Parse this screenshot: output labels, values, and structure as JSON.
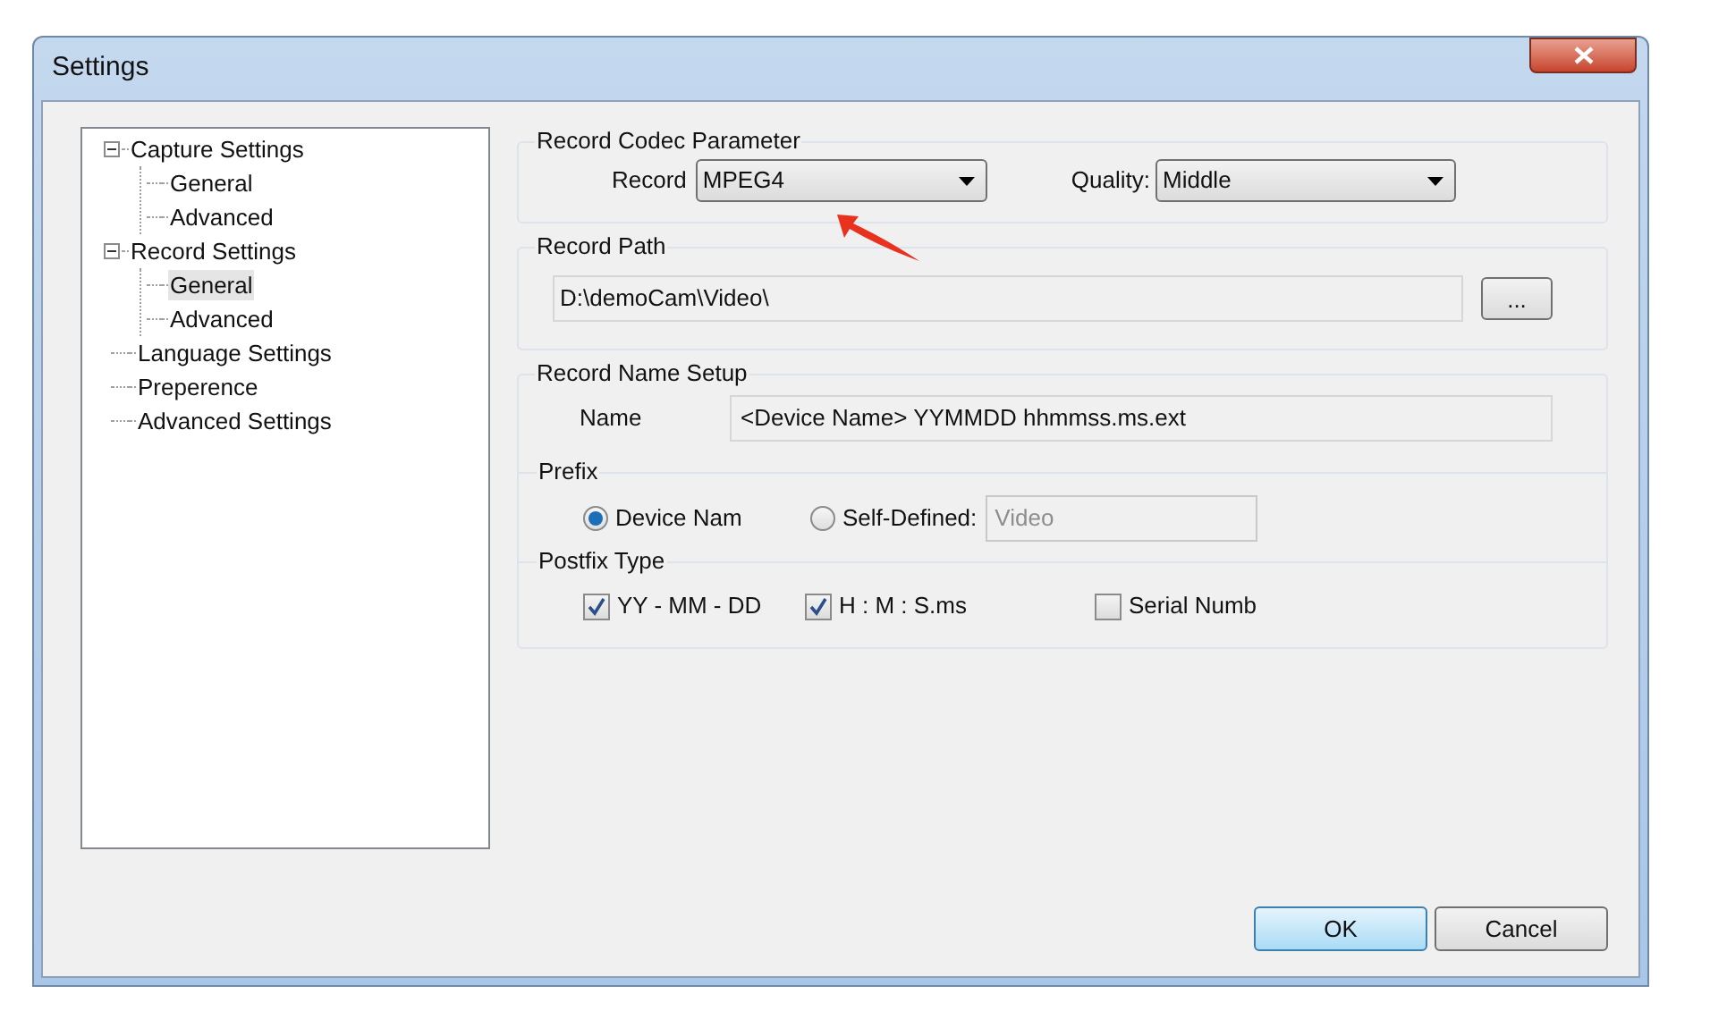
{
  "window": {
    "title": "Settings"
  },
  "tree": [
    {
      "label": "Capture Settings",
      "expanded": true,
      "selected": false,
      "children": [
        {
          "label": "General",
          "selected": false
        },
        {
          "label": "Advanced",
          "selected": false
        }
      ]
    },
    {
      "label": "Record Settings",
      "expanded": true,
      "selected": false,
      "children": [
        {
          "label": "General",
          "selected": true
        },
        {
          "label": "Advanced",
          "selected": false
        }
      ]
    },
    {
      "label": "Language Settings",
      "selected": false
    },
    {
      "label": "Preperence",
      "selected": false
    },
    {
      "label": "Advanced Settings",
      "selected": false
    }
  ],
  "codec": {
    "title": "Record Codec Parameter",
    "record": {
      "label": "Record",
      "value": "MPEG4"
    },
    "quality": {
      "label": "Quality:",
      "value": "Middle"
    }
  },
  "path": {
    "title": "Record Path",
    "value": "D:\\demoCam\\Video\\",
    "browse": "..."
  },
  "name_setup": {
    "title": "Record Name Setup",
    "name_label": "Name",
    "name_value": "<Device Name> YYMMDD hhmmss.ms.ext"
  },
  "prefix": {
    "title": "Prefix",
    "options": [
      {
        "label": "Device Nam",
        "selected": true
      },
      {
        "label": "Self-Defined:",
        "selected": false
      }
    ],
    "custom_value": "Video",
    "custom_disabled": true
  },
  "postfix": {
    "title": "Postfix Type",
    "options": [
      {
        "label": "YY - MM - DD",
        "checked": true
      },
      {
        "label": "H : M : S.ms",
        "checked": true
      },
      {
        "label": "Serial Numb",
        "checked": false
      }
    ]
  },
  "buttons": [
    {
      "label": "OK",
      "default": true
    },
    {
      "label": "Cancel",
      "default": false
    }
  ]
}
